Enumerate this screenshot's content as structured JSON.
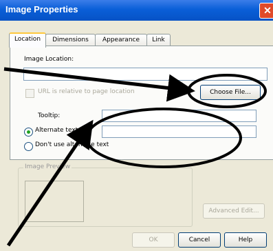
{
  "window": {
    "title": "Image Properties",
    "close_glyph": "✕"
  },
  "tabs": [
    {
      "label": "Location",
      "active": true
    },
    {
      "label": "Dimensions",
      "active": false
    },
    {
      "label": "Appearance",
      "active": false
    },
    {
      "label": "Link",
      "active": false
    }
  ],
  "location": {
    "image_location_label": "Image Location:",
    "image_location_value": "",
    "url_relative_label": "URL is relative to page location",
    "url_relative_checked": false,
    "choose_file_label": "Choose File...",
    "tooltip_label": "Tooltip:",
    "tooltip_value": "",
    "alternate_text_label": "Alternate text:",
    "alternate_text_value": "",
    "alternate_text_selected": true,
    "dont_use_alt_label": "Don't use alternate text",
    "dont_use_alt_selected": false
  },
  "preview": {
    "group_label": "Image Preview",
    "advanced_edit_label": "Advanced Edit..."
  },
  "footer": {
    "ok_label": "OK",
    "cancel_label": "Cancel",
    "help_label": "Help"
  },
  "annotation": {
    "color": "#000000"
  }
}
